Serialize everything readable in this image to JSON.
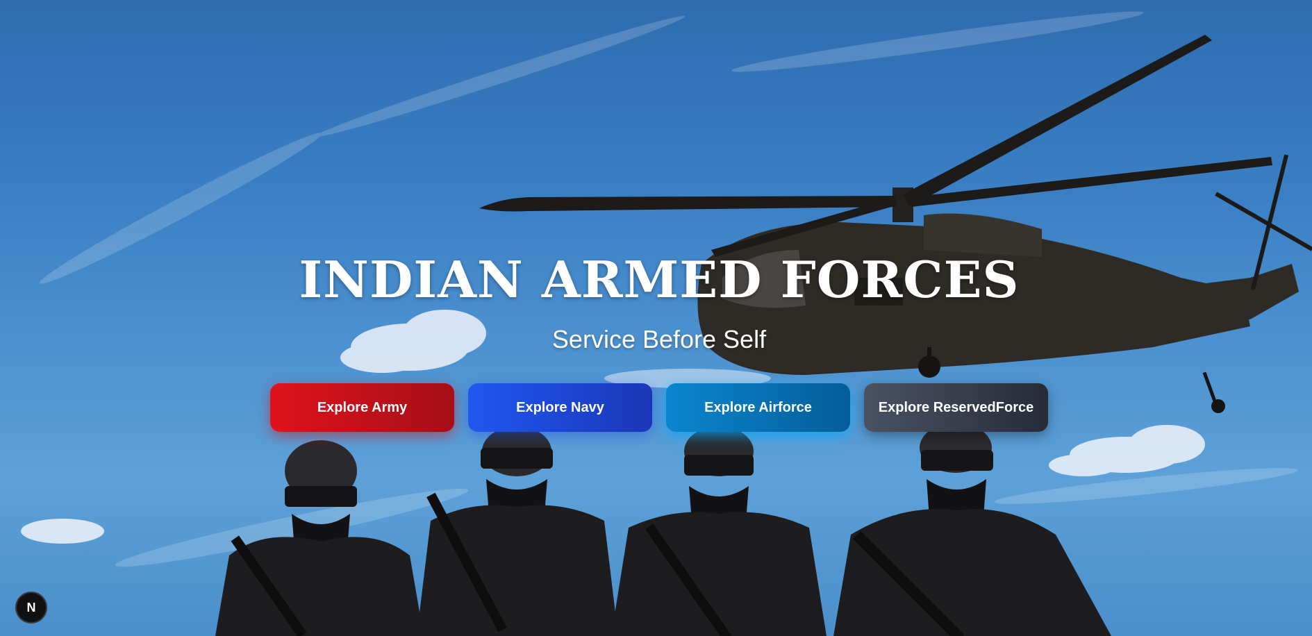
{
  "hero": {
    "title": "INDIAN ARMED FORCES",
    "subtitle": "Service Before Self"
  },
  "buttons": [
    {
      "label": "Explore Army",
      "color": "#e0121c"
    },
    {
      "label": "Explore Navy",
      "color": "#1e58f0"
    },
    {
      "label": "Explore Airforce",
      "color": "#0a86d0"
    },
    {
      "label": "Explore ReservedForce",
      "color": "#3a4150"
    }
  ],
  "fab": {
    "label": "N"
  },
  "colors": {
    "sky": "#3a7fc4",
    "text": "#ffffff"
  }
}
